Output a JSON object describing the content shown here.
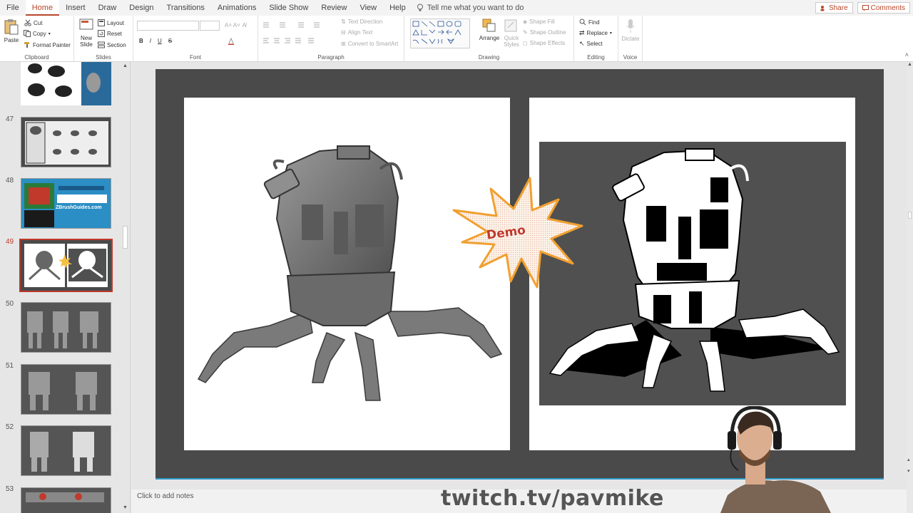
{
  "menu": {
    "tabs": [
      "File",
      "Home",
      "Insert",
      "Draw",
      "Design",
      "Transitions",
      "Animations",
      "Slide Show",
      "Review",
      "View",
      "Help"
    ],
    "active_tab": "Home",
    "tell_me": "Tell me what you want to do",
    "share": "Share",
    "comments": "Comments"
  },
  "ribbon": {
    "clipboard": {
      "paste": "Paste",
      "cut": "Cut",
      "copy": "Copy",
      "format_painter": "Format Painter",
      "label": "Clipboard"
    },
    "slides": {
      "new_slide": "New Slide",
      "layout": "Layout",
      "reset": "Reset",
      "section": "Section",
      "label": "Slides"
    },
    "font": {
      "label": "Font",
      "bold": "B",
      "italic": "I",
      "underline": "U",
      "strike": "S"
    },
    "paragraph": {
      "text_direction": "Text Direction",
      "align_text": "Align Text",
      "convert_smartart": "Convert to SmartArt",
      "label": "Paragraph"
    },
    "drawing": {
      "arrange": "Arrange",
      "quick_styles": "Quick Styles",
      "shape_fill": "Shape Fill",
      "shape_outline": "Shape Outline",
      "shape_effects": "Shape Effects",
      "label": "Drawing"
    },
    "editing": {
      "find": "Find",
      "replace": "Replace",
      "select": "Select",
      "label": "Editing"
    },
    "voice": {
      "dictate": "Dictate",
      "label": "Voice"
    }
  },
  "thumbnails": [
    {
      "num": "47",
      "selected": false
    },
    {
      "num": "48",
      "selected": false,
      "caption": "ZBrushGuides.com"
    },
    {
      "num": "49",
      "selected": true
    },
    {
      "num": "50",
      "selected": false
    },
    {
      "num": "51",
      "selected": false
    },
    {
      "num": "52",
      "selected": false
    },
    {
      "num": "53",
      "selected": false
    }
  ],
  "slide": {
    "burst_text": "Demo",
    "burst_color": "#c0392b",
    "accent": "#2e9ac7"
  },
  "notes": {
    "placeholder": "Click to add notes"
  },
  "watermark": "twitch.tv/pavmike",
  "colors": {
    "brand": "#b7472a",
    "slide_bg": "#4a4a4a",
    "selection": "#c0392b"
  }
}
